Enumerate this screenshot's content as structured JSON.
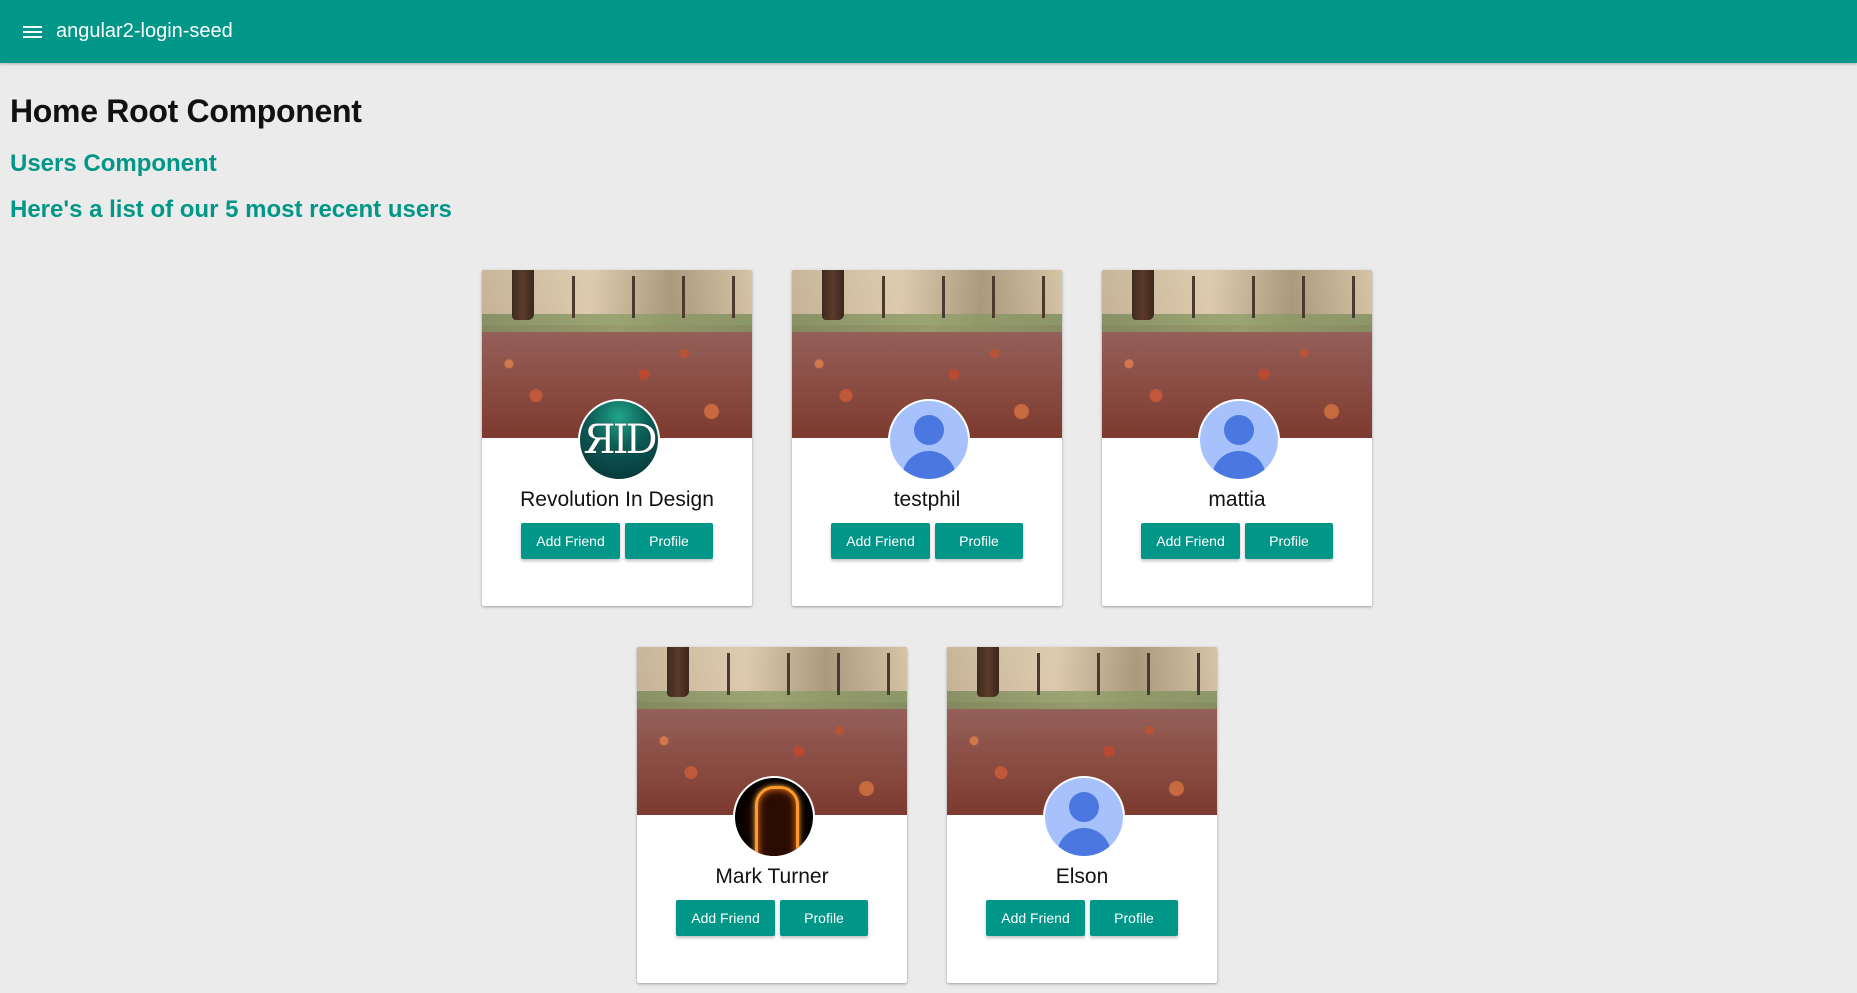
{
  "toolbar": {
    "menu_icon": "menu-icon",
    "title": "angular2-login-seed",
    "color": "#009688"
  },
  "main": {
    "heading": "Home Root Component",
    "subheading": "Users Component",
    "list_heading": "Here's a list of our 5 most recent users"
  },
  "users": [
    {
      "name": "Revolution In Design",
      "avatar": "rid-logo",
      "avatar_text": "ЯID",
      "add_friend": "Add Friend",
      "profile": "Profile"
    },
    {
      "name": "testphil",
      "avatar": "default-person-icon",
      "add_friend": "Add Friend",
      "profile": "Profile"
    },
    {
      "name": "mattia",
      "avatar": "default-person-icon",
      "add_friend": "Add Friend",
      "profile": "Profile"
    },
    {
      "name": "Mark Turner",
      "avatar": "fire-figure-photo",
      "add_friend": "Add Friend",
      "profile": "Profile"
    },
    {
      "name": "Elson",
      "avatar": "default-person-icon",
      "add_friend": "Add Friend",
      "profile": "Profile"
    }
  ]
}
